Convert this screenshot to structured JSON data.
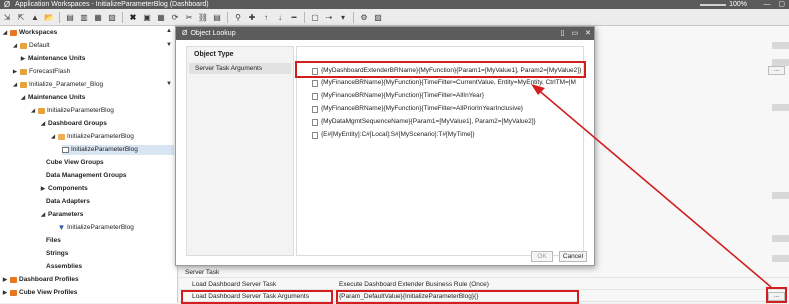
{
  "window": {
    "title": "Application Workspaces - InitializeParameterBlog (Dashboard)",
    "zoom": "100%"
  },
  "tree": {
    "items": [
      {
        "label": "Workspaces",
        "bold": true
      },
      {
        "label": "Default",
        "bold": false
      },
      {
        "label": "Maintenance Units",
        "bold": true
      },
      {
        "label": "ForecastFlash",
        "bold": false
      },
      {
        "label": "Initialize_Parameter_Blog",
        "bold": false
      },
      {
        "label": "Maintenance Units",
        "bold": true
      },
      {
        "label": "InitializeParameterBlog",
        "bold": false
      },
      {
        "label": "Dashboard Groups",
        "bold": true
      },
      {
        "label": "InitializeParameterBlog",
        "bold": false
      },
      {
        "label": "InitializeParameterBlog",
        "bold": false
      },
      {
        "label": "Cube View Groups",
        "bold": true
      },
      {
        "label": "Data Management Groups",
        "bold": true
      },
      {
        "label": "Components",
        "bold": true
      },
      {
        "label": "Data Adapters",
        "bold": true
      },
      {
        "label": "Parameters",
        "bold": true
      },
      {
        "label": "InitializeParameterBlog",
        "bold": false
      },
      {
        "label": "Files",
        "bold": true
      },
      {
        "label": "Strings",
        "bold": true
      },
      {
        "label": "Assemblies",
        "bold": true
      },
      {
        "label": "Dashboard Profiles",
        "bold": true
      },
      {
        "label": "Cube View Profiles",
        "bold": true
      }
    ]
  },
  "properties": {
    "section": "Server Task",
    "rows": [
      {
        "key": "Load Dashboard Server Task",
        "value": "Execute Dashboard Extender Business Rule (Once)"
      },
      {
        "key": "Load Dashboard Server Task Arguments",
        "value": "{Param_DefaultValue}{InitializeParameterBlog}{}"
      }
    ],
    "ellipsis": "..."
  },
  "dialog": {
    "title": "Object Lookup",
    "left_header": "Object Type",
    "left_item": "Server Task Arguments",
    "items": [
      "{MyDashboardExtenderBRName}{MyFunction}{Param1=[MyValue1], Param2=[MyValue2]}",
      "{MyFinanceBRName}{MyFunction}{TimeFilter=CurrentValue, Entity=MyEntity, CtrlTM=|MyDepartment|}",
      "{MyFinanceBRName}{MyFunction}{TimeFilter=AllInYear}",
      "{MyFinanceBRName}{MyFunction}{TimeFilter=AllPriorInYearInclusive}",
      "{MyDataMgmtSequenceName}{Param1=[MyValue1], Param2=[MyValue2]}",
      "{E#[MyEntity]:C#[Local]:S#[MyScenario]:T#[MyTime]}"
    ],
    "ok_label": "OK",
    "cancel_label": "Cancel"
  },
  "colors": {
    "highlight": "#d11f1f",
    "titlebar": "#5a5a5a",
    "folder": "#e6a23c",
    "selection": "#d9e5f3"
  }
}
